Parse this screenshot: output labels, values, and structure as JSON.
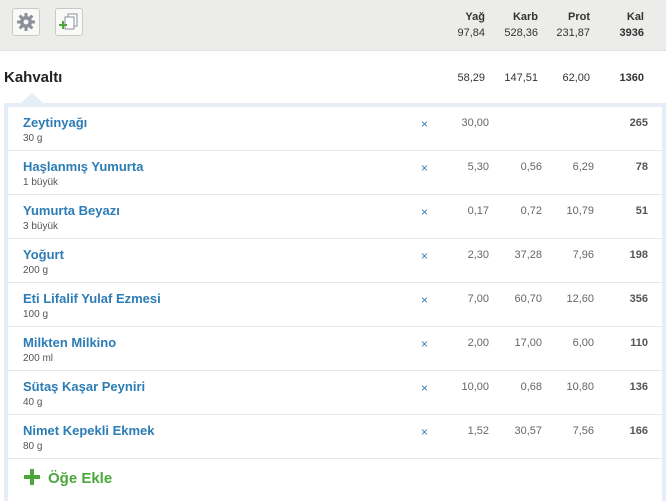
{
  "toolbar": {
    "settings_icon": "gear-icon",
    "copy_icon": "copy-add-icon"
  },
  "columns": {
    "fat": {
      "label": "Yağ",
      "total": "97,84"
    },
    "carb": {
      "label": "Karb",
      "total": "528,36"
    },
    "prot": {
      "label": "Prot",
      "total": "231,87"
    },
    "cal": {
      "label": "Kal",
      "total": "3936"
    }
  },
  "meal": {
    "title": "Kahvaltı",
    "fat": "58,29",
    "carb": "147,51",
    "prot": "62,00",
    "cal": "1360"
  },
  "items": [
    {
      "name": "Zeytinyağı",
      "qty": "30 g",
      "fat": "30,00",
      "carb": "",
      "prot": "",
      "cal": "265"
    },
    {
      "name": "Haşlanmış Yumurta",
      "qty": "1 büyük",
      "fat": "5,30",
      "carb": "0,56",
      "prot": "6,29",
      "cal": "78"
    },
    {
      "name": "Yumurta Beyazı",
      "qty": "3 büyük",
      "fat": "0,17",
      "carb": "0,72",
      "prot": "10,79",
      "cal": "51"
    },
    {
      "name": "Yoğurt",
      "qty": "200 g",
      "fat": "2,30",
      "carb": "37,28",
      "prot": "7,96",
      "cal": "198"
    },
    {
      "name": "Eti Lifalif Yulaf Ezmesi",
      "qty": "100 g",
      "fat": "7,00",
      "carb": "60,70",
      "prot": "12,60",
      "cal": "356"
    },
    {
      "name": "Milkten Milkino",
      "qty": "200 ml",
      "fat": "2,00",
      "carb": "17,00",
      "prot": "6,00",
      "cal": "110"
    },
    {
      "name": "Sütaş Kaşar Peyniri",
      "qty": "40 g",
      "fat": "10,00",
      "carb": "0,68",
      "prot": "10,80",
      "cal": "136"
    },
    {
      "name": "Nimet Kepekli Ekmek",
      "qty": "80 g",
      "fat": "1,52",
      "carb": "30,57",
      "prot": "7,56",
      "cal": "166"
    }
  ],
  "delete_glyph": "×",
  "add_label": "Öğe Ekle"
}
